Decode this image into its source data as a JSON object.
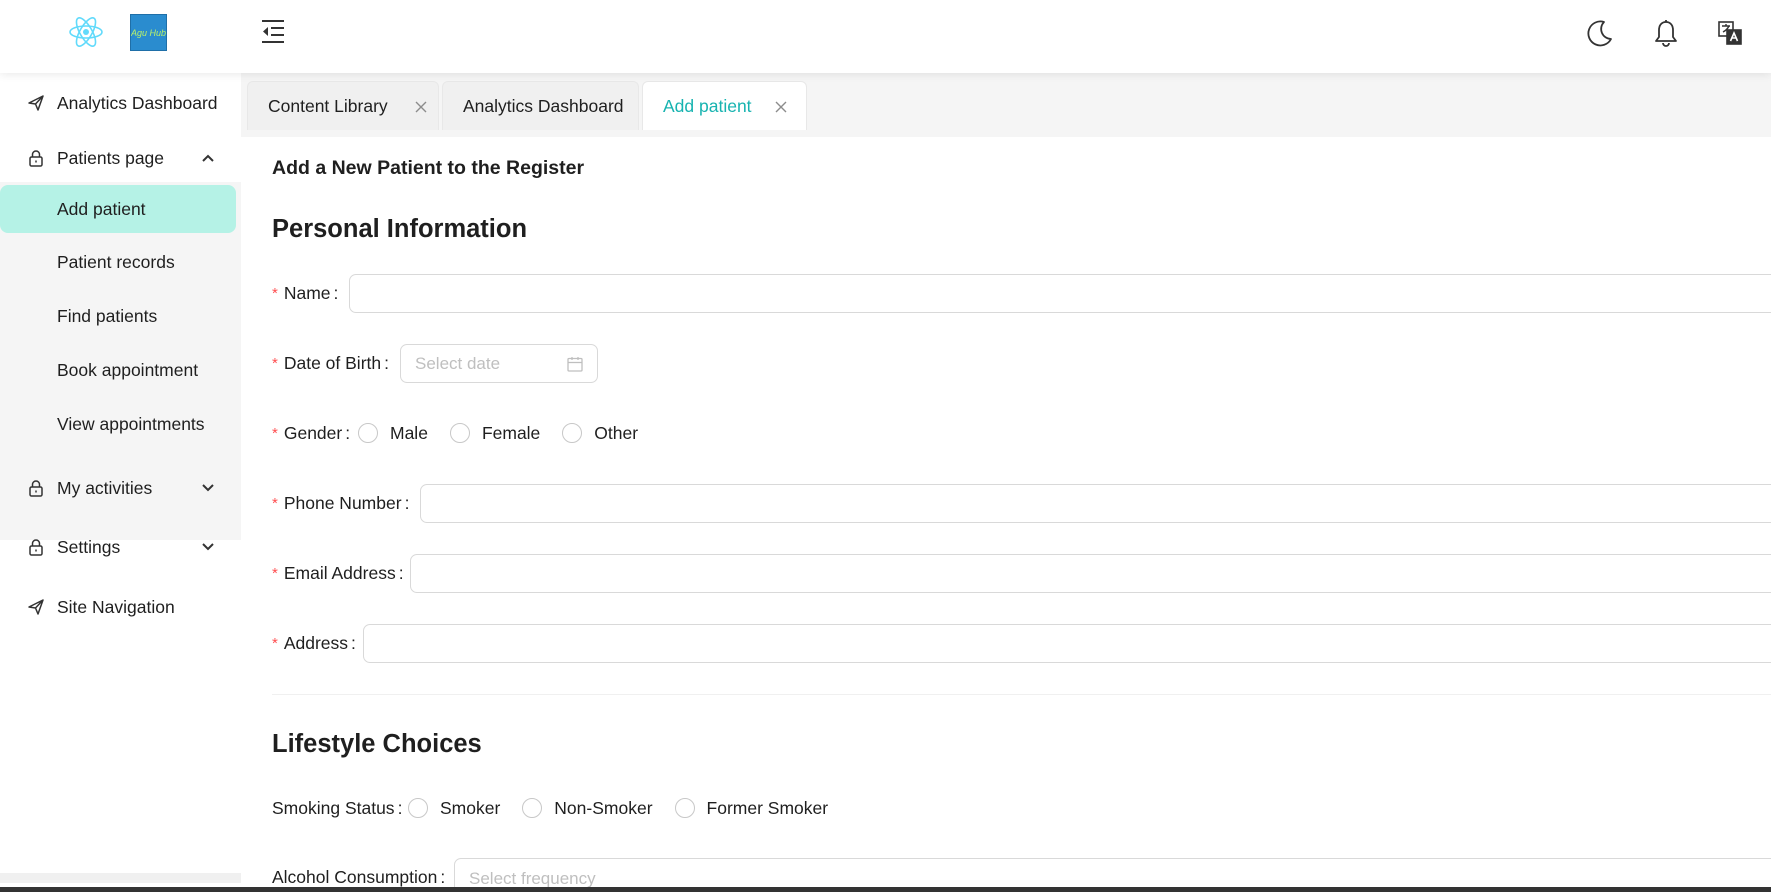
{
  "header": {
    "logo_text": "Agu Hub",
    "icons": [
      "react-logo",
      "brand-logo",
      "menu-fold-icon",
      "moon-icon",
      "bell-icon",
      "translate-icon"
    ]
  },
  "sidebar": {
    "items": [
      {
        "label": "Analytics Dashboard",
        "icon": "send-icon"
      },
      {
        "label": "Patients page",
        "icon": "lock-icon",
        "expanded": true
      },
      {
        "label": "My activities",
        "icon": "lock-icon",
        "expanded": false
      },
      {
        "label": "Settings",
        "icon": "lock-icon",
        "expanded": false
      },
      {
        "label": "Site Navigation",
        "icon": "send-icon"
      }
    ],
    "patients_sub": [
      {
        "label": "Add patient",
        "active": true
      },
      {
        "label": "Patient records"
      },
      {
        "label": "Find patients"
      },
      {
        "label": "Book appointment"
      },
      {
        "label": "View appointments"
      }
    ]
  },
  "tabs": [
    {
      "label": "Content Library",
      "closable": true
    },
    {
      "label": "Analytics Dashboard",
      "closable": false
    },
    {
      "label": "Add patient",
      "closable": true,
      "active": true
    }
  ],
  "colors": {
    "accent": "#17b3b0",
    "active_menu_bg": "#b5f2e6",
    "required": "#ff4d4f"
  },
  "form": {
    "page_title": "Add a New Patient to the Register",
    "personal_section": "Personal Information",
    "name_label": "Name",
    "dob_label": "Date of Birth",
    "dob_placeholder": "Select date",
    "gender_label": "Gender",
    "gender_options": [
      "Male",
      "Female",
      "Other"
    ],
    "phone_label": "Phone Number",
    "email_label": "Email Address",
    "address_label": "Address",
    "lifestyle_section": "Lifestyle Choices",
    "smoking_label": "Smoking Status",
    "smoking_options": [
      "Smoker",
      "Non-Smoker",
      "Former Smoker"
    ],
    "alcohol_label": "Alcohol Consumption",
    "alcohol_placeholder": "Select frequency"
  }
}
